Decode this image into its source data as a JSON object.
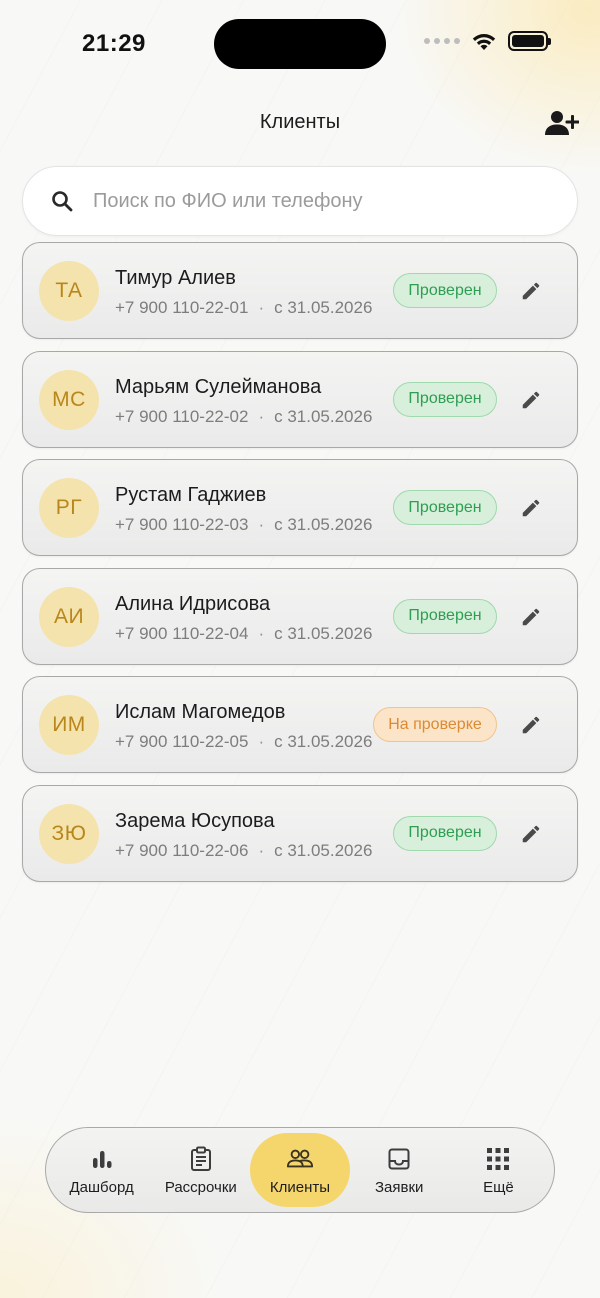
{
  "status_bar": {
    "time": "21:29"
  },
  "header": {
    "title": "Клиенты",
    "add_client_icon": "person-add-icon"
  },
  "search": {
    "placeholder": "Поиск по ФИО или телефону",
    "value": "",
    "icon": "search-icon"
  },
  "clients": [
    {
      "initials": "ТА",
      "name": "Тимур Алиев",
      "phone": "+7 900 110-22-01",
      "since": "с 31.05.2026",
      "status": "Проверен",
      "status_kind": "ok"
    },
    {
      "initials": "МС",
      "name": "Марьям Сулейманова",
      "phone": "+7 900 110-22-02",
      "since": "с 31.05.2026",
      "status": "Проверен",
      "status_kind": "ok"
    },
    {
      "initials": "РГ",
      "name": "Рустам Гаджиев",
      "phone": "+7 900 110-22-03",
      "since": "с 31.05.2026",
      "status": "Проверен",
      "status_kind": "ok"
    },
    {
      "initials": "АИ",
      "name": "Алина Идрисова",
      "phone": "+7 900 110-22-04",
      "since": "с 31.05.2026",
      "status": "Проверен",
      "status_kind": "ok"
    },
    {
      "initials": "ИМ",
      "name": "Ислам Магомедов",
      "phone": "+7 900 110-22-05",
      "since": "с 31.05.2026",
      "status": "На проверке",
      "status_kind": "pending"
    },
    {
      "initials": "ЗЮ",
      "name": "Зарема Юсупова",
      "phone": "+7 900 110-22-06",
      "since": "с 31.05.2026",
      "status": "Проверен",
      "status_kind": "ok"
    }
  ],
  "meta_separator": "·",
  "tabbar": {
    "active": "clients",
    "items": [
      {
        "id": "dashboard",
        "label": "Дашборд",
        "icon": "bar-chart-icon"
      },
      {
        "id": "installments",
        "label": "Рассрочки",
        "icon": "clipboard-icon"
      },
      {
        "id": "clients",
        "label": "Клиенты",
        "icon": "people-icon"
      },
      {
        "id": "requests",
        "label": "Заявки",
        "icon": "inbox-icon"
      },
      {
        "id": "more",
        "label": "Ещё",
        "icon": "grid-icon"
      }
    ]
  },
  "colors": {
    "accent": "#f5d66c",
    "avatar_bg": "#f5e3ad",
    "avatar_text": "#b8871c",
    "status_ok_text": "#2f9e52",
    "status_ok_bg": "#d7efdb",
    "status_pending_text": "#dc8a33",
    "status_pending_bg": "#fbe4c7"
  }
}
